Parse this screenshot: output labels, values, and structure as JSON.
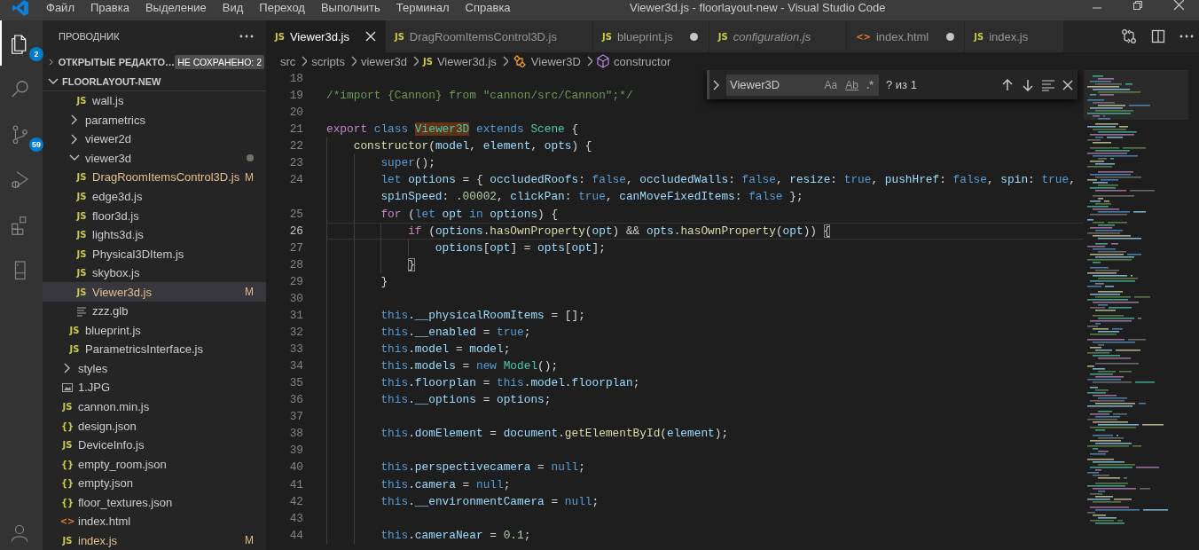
{
  "title_bar": {
    "menu": [
      "Файл",
      "Правка",
      "Выделение",
      "Вид",
      "Переход",
      "Выполнить",
      "Терминал",
      "Справка"
    ],
    "title": "Viewer3d.js - floorlayout-new - Visual Studio Code"
  },
  "activity_bar": {
    "items": [
      {
        "kind": "explorer",
        "selected": true,
        "badge": "2"
      },
      {
        "kind": "search",
        "selected": false
      },
      {
        "kind": "source-control",
        "selected": false,
        "badge": "59"
      },
      {
        "kind": "run-debug",
        "selected": false
      },
      {
        "kind": "extensions",
        "selected": false
      },
      {
        "kind": "device",
        "selected": false
      }
    ],
    "bottom": [
      {
        "kind": "account",
        "selected": false
      }
    ]
  },
  "sidebar": {
    "title": "ПРОВОДНИК",
    "sections": [
      {
        "label": "ОТКРЫТЫЕ РЕДАКТО…",
        "expanded": false,
        "badge": "НЕ СОХРАНЕНО: 2"
      },
      {
        "label": "FLOORLAYOUT-NEW",
        "expanded": true,
        "tree": [
          {
            "children": [
              {
                "children": [
                  {
                    "label": "wall.js",
                    "kind": "js",
                    "icon": "JS",
                    "selected": false
                  }
                ]
              },
              {
                "label": "parametrics",
                "kind": "folder",
                "expanded": false,
                "selected": false
              },
              {
                "label": "viewer2d",
                "kind": "folder",
                "expanded": false,
                "selected": false
              },
              {
                "label": "viewer3d",
                "kind": "folder",
                "expanded": true,
                "modified": true,
                "selected": false,
                "children": [
                  {
                    "label": "DragRoomItemsControl3D.js",
                    "kind": "js",
                    "icon": "JS",
                    "status": "M",
                    "selected": false
                  },
                  {
                    "label": "edge3d.js",
                    "kind": "js",
                    "icon": "JS",
                    "selected": false
                  },
                  {
                    "label": "floor3d.js",
                    "kind": "js",
                    "icon": "JS",
                    "selected": false
                  },
                  {
                    "label": "lights3d.js",
                    "kind": "js",
                    "icon": "JS",
                    "selected": false
                  },
                  {
                    "label": "Physical3DItem.js",
                    "kind": "js",
                    "icon": "JS",
                    "selected": false
                  },
                  {
                    "label": "skybox.js",
                    "kind": "js",
                    "icon": "JS",
                    "selected": false
                  },
                  {
                    "label": "Viewer3d.js",
                    "kind": "js",
                    "icon": "JS",
                    "status": "M",
                    "selected": true
                  },
                  {
                    "label": "zzz.glb",
                    "kind": "text",
                    "selected": false
                  }
                ]
              },
              {
                "label": "blueprint.js",
                "kind": "js",
                "icon": "JS",
                "selected": false
              },
              {
                "label": "ParametricsInterface.js",
                "kind": "js",
                "icon": "JS",
                "selected": false
              }
            ]
          },
          {
            "label": "styles",
            "kind": "folder",
            "expanded": false,
            "selected": false
          },
          {
            "label": "1.JPG",
            "kind": "image",
            "selected": false
          },
          {
            "label": "cannon.min.js",
            "kind": "js",
            "icon": "JS",
            "selected": false
          },
          {
            "label": "design.json",
            "kind": "json",
            "icon": "{}",
            "selected": false
          },
          {
            "label": "DeviceInfo.js",
            "kind": "js",
            "icon": "JS",
            "selected": false
          },
          {
            "label": "empty_room.json",
            "kind": "json",
            "icon": "{}",
            "selected": false
          },
          {
            "label": "empty.json",
            "kind": "json",
            "icon": "{}",
            "selected": false
          },
          {
            "label": "floor_textures.json",
            "kind": "json",
            "icon": "{}",
            "selected": false
          },
          {
            "label": "index.html",
            "kind": "html",
            "icon": "<>",
            "selected": false
          },
          {
            "label": "index.js",
            "kind": "js",
            "icon": "JS",
            "status": "M",
            "selected": false
          }
        ]
      }
    ]
  },
  "tabs": [
    {
      "label": "Viewer3d.js",
      "kind": "js",
      "icon": "JS",
      "selected": true,
      "dirty": false,
      "preview": false
    },
    {
      "label": "DragRoomItemsControl3D.js",
      "kind": "js",
      "icon": "JS",
      "selected": false,
      "dirty": false,
      "preview": false
    },
    {
      "label": "blueprint.js",
      "kind": "js",
      "icon": "JS",
      "selected": false,
      "dirty": true,
      "preview": false
    },
    {
      "label": "configuration.js",
      "kind": "js",
      "icon": "JS",
      "selected": false,
      "dirty": false,
      "preview": true
    },
    {
      "label": "index.html",
      "kind": "html",
      "icon": "<>",
      "selected": false,
      "dirty": true,
      "preview": false
    },
    {
      "label": "index.js",
      "kind": "js",
      "icon": "JS",
      "selected": false,
      "dirty": false,
      "preview": false
    }
  ],
  "breadcrumbs": [
    {
      "label": "src",
      "kind": "folder"
    },
    {
      "label": "scripts",
      "kind": "folder"
    },
    {
      "label": "viewer3d",
      "kind": "folder"
    },
    {
      "label": "Viewer3d.js",
      "kind": "js",
      "icon": "JS"
    },
    {
      "label": "Viewer3D",
      "kind": "class"
    },
    {
      "label": "constructor",
      "kind": "method"
    }
  ],
  "find_widget": {
    "expanded": false,
    "value": "Viewer3D",
    "options": [
      {
        "kind": "match-case",
        "label": "Aa",
        "on": false
      },
      {
        "kind": "whole-word",
        "label": "Ab",
        "on": false
      },
      {
        "kind": "regex",
        "label": ".*",
        "on": false
      }
    ],
    "result": "? из 1"
  },
  "editor": {
    "lines": [
      {
        "number": "18",
        "current": false
      },
      {
        "number": "19",
        "current": false,
        "tokens": [
          {
            "kind": "comment",
            "text": "/*import {Cannon} from \"cannon/src/Cannon\";*/"
          }
        ]
      },
      {
        "number": "20",
        "current": false
      },
      {
        "number": "21",
        "current": false,
        "tokens": [
          {
            "kind": "control",
            "text": "export "
          },
          {
            "kind": "keyword",
            "text": "class "
          },
          {
            "kind": "find-match",
            "text": "Viewer3D"
          },
          {
            "kind": "keyword",
            "text": " extends "
          },
          {
            "kind": "type",
            "text": "Scene"
          },
          {
            "kind": "plain",
            "text": " {"
          }
        ]
      },
      {
        "number": "22",
        "current": false,
        "tokens": [
          {
            "kind": "function",
            "text": "    constructor"
          },
          {
            "kind": "plain",
            "text": "("
          },
          {
            "kind": "variable",
            "text": "model"
          },
          {
            "kind": "plain",
            "text": ", "
          },
          {
            "kind": "variable",
            "text": "element"
          },
          {
            "kind": "plain",
            "text": ", "
          },
          {
            "kind": "variable",
            "text": "opts"
          },
          {
            "kind": "plain",
            "text": ") {"
          }
        ]
      },
      {
        "number": "23",
        "current": false,
        "tokens": [
          {
            "kind": "keyword",
            "text": "        super"
          },
          {
            "kind": "plain",
            "text": "();"
          }
        ]
      },
      {
        "number": "24",
        "current": false,
        "tokens": [
          {
            "kind": "keyword",
            "text": "        let "
          },
          {
            "kind": "variable",
            "text": "options"
          },
          {
            "kind": "plain",
            "text": " = { "
          },
          {
            "kind": "variable",
            "text": "occludedRoofs"
          },
          {
            "kind": "plain",
            "text": ": "
          },
          {
            "kind": "keyword",
            "text": "false"
          },
          {
            "kind": "plain",
            "text": ", "
          },
          {
            "kind": "variable",
            "text": "occludedWalls"
          },
          {
            "kind": "plain",
            "text": ": "
          },
          {
            "kind": "keyword",
            "text": "false"
          },
          {
            "kind": "plain",
            "text": ", "
          },
          {
            "kind": "variable",
            "text": "resize"
          },
          {
            "kind": "plain",
            "text": ": "
          },
          {
            "kind": "keyword",
            "text": "true"
          },
          {
            "kind": "plain",
            "text": ", "
          },
          {
            "kind": "variable",
            "text": "pushHref"
          },
          {
            "kind": "plain",
            "text": ": "
          },
          {
            "kind": "keyword",
            "text": "false"
          },
          {
            "kind": "plain",
            "text": ", "
          },
          {
            "kind": "variable",
            "text": "spin"
          },
          {
            "kind": "plain",
            "text": ": "
          },
          {
            "kind": "keyword",
            "text": "true"
          },
          {
            "kind": "plain",
            "text": ","
          }
        ]
      },
      {
        "current": false,
        "tokens": [
          {
            "kind": "variable",
            "text": "        spinSpeed"
          },
          {
            "kind": "plain",
            "text": ": "
          },
          {
            "kind": "number",
            "text": ".00002"
          },
          {
            "kind": "plain",
            "text": ", "
          },
          {
            "kind": "variable",
            "text": "clickPan"
          },
          {
            "kind": "plain",
            "text": ": "
          },
          {
            "kind": "keyword",
            "text": "true"
          },
          {
            "kind": "plain",
            "text": ", "
          },
          {
            "kind": "variable",
            "text": "canMoveFixedItems"
          },
          {
            "kind": "plain",
            "text": ": "
          },
          {
            "kind": "keyword",
            "text": "false"
          },
          {
            "kind": "plain",
            "text": " };"
          }
        ]
      },
      {
        "number": "25",
        "current": false,
        "tokens": [
          {
            "kind": "control",
            "text": "        for"
          },
          {
            "kind": "plain",
            "text": " ("
          },
          {
            "kind": "keyword",
            "text": "let "
          },
          {
            "kind": "variable",
            "text": "opt"
          },
          {
            "kind": "keyword",
            "text": " in "
          },
          {
            "kind": "variable",
            "text": "options"
          },
          {
            "kind": "plain",
            "text": ") {"
          }
        ]
      },
      {
        "number": "26",
        "current": true,
        "tokens": [
          {
            "kind": "control",
            "text": "            if"
          },
          {
            "kind": "plain",
            "text": " ("
          },
          {
            "kind": "variable",
            "text": "options"
          },
          {
            "kind": "plain",
            "text": "."
          },
          {
            "kind": "function",
            "text": "hasOwnProperty"
          },
          {
            "kind": "plain",
            "text": "("
          },
          {
            "kind": "variable",
            "text": "opt"
          },
          {
            "kind": "plain",
            "text": ") && "
          },
          {
            "kind": "variable",
            "text": "opts"
          },
          {
            "kind": "plain",
            "text": "."
          },
          {
            "kind": "function",
            "text": "hasOwnProperty"
          },
          {
            "kind": "plain",
            "text": "("
          },
          {
            "kind": "variable",
            "text": "opt"
          },
          {
            "kind": "plain",
            "text": ")) "
          },
          {
            "kind": "bracket-match",
            "text": "{"
          }
        ]
      },
      {
        "number": "27",
        "current": false,
        "tokens": [
          {
            "kind": "variable",
            "text": "                options"
          },
          {
            "kind": "plain",
            "text": "["
          },
          {
            "kind": "variable",
            "text": "opt"
          },
          {
            "kind": "plain",
            "text": "] = "
          },
          {
            "kind": "variable",
            "text": "opts"
          },
          {
            "kind": "plain",
            "text": "["
          },
          {
            "kind": "variable",
            "text": "opt"
          },
          {
            "kind": "plain",
            "text": "];"
          }
        ]
      },
      {
        "number": "28",
        "current": false,
        "tokens": [
          {
            "kind": "bracket-match",
            "text": "            }"
          }
        ]
      },
      {
        "number": "29",
        "current": false,
        "tokens": [
          {
            "kind": "plain",
            "text": "        }"
          }
        ]
      },
      {
        "number": "30",
        "current": false
      },
      {
        "number": "31",
        "current": false,
        "tokens": [
          {
            "kind": "keyword",
            "text": "        this"
          },
          {
            "kind": "plain",
            "text": "."
          },
          {
            "kind": "variable",
            "text": "__physicalRoomItems"
          },
          {
            "kind": "plain",
            "text": " = [];"
          }
        ]
      },
      {
        "number": "32",
        "current": false,
        "tokens": [
          {
            "kind": "keyword",
            "text": "        this"
          },
          {
            "kind": "plain",
            "text": "."
          },
          {
            "kind": "variable",
            "text": "__enabled"
          },
          {
            "kind": "plain",
            "text": " = "
          },
          {
            "kind": "keyword",
            "text": "true"
          },
          {
            "kind": "plain",
            "text": ";"
          }
        ]
      },
      {
        "number": "33",
        "current": false,
        "tokens": [
          {
            "kind": "keyword",
            "text": "        this"
          },
          {
            "kind": "plain",
            "text": "."
          },
          {
            "kind": "variable",
            "text": "model"
          },
          {
            "kind": "plain",
            "text": " = "
          },
          {
            "kind": "variable",
            "text": "model"
          },
          {
            "kind": "plain",
            "text": ";"
          }
        ]
      },
      {
        "number": "34",
        "current": false,
        "tokens": [
          {
            "kind": "keyword",
            "text": "        this"
          },
          {
            "kind": "plain",
            "text": "."
          },
          {
            "kind": "variable",
            "text": "models"
          },
          {
            "kind": "plain",
            "text": " = "
          },
          {
            "kind": "keyword",
            "text": "new "
          },
          {
            "kind": "type",
            "text": "Model"
          },
          {
            "kind": "plain",
            "text": "();"
          }
        ]
      },
      {
        "number": "35",
        "current": false,
        "tokens": [
          {
            "kind": "keyword",
            "text": "        this"
          },
          {
            "kind": "plain",
            "text": "."
          },
          {
            "kind": "variable",
            "text": "floorplan"
          },
          {
            "kind": "plain",
            "text": " = "
          },
          {
            "kind": "keyword",
            "text": "this"
          },
          {
            "kind": "plain",
            "text": "."
          },
          {
            "kind": "variable",
            "text": "model"
          },
          {
            "kind": "plain",
            "text": "."
          },
          {
            "kind": "variable",
            "text": "floorplan"
          },
          {
            "kind": "plain",
            "text": ";"
          }
        ]
      },
      {
        "number": "36",
        "current": false,
        "tokens": [
          {
            "kind": "keyword",
            "text": "        this"
          },
          {
            "kind": "plain",
            "text": "."
          },
          {
            "kind": "variable",
            "text": "__options"
          },
          {
            "kind": "plain",
            "text": " = "
          },
          {
            "kind": "variable",
            "text": "options"
          },
          {
            "kind": "plain",
            "text": ";"
          }
        ]
      },
      {
        "number": "37",
        "current": false
      },
      {
        "number": "38",
        "current": false,
        "tokens": [
          {
            "kind": "keyword",
            "text": "        this"
          },
          {
            "kind": "plain",
            "text": "."
          },
          {
            "kind": "variable",
            "text": "domElement"
          },
          {
            "kind": "plain",
            "text": " = "
          },
          {
            "kind": "variable",
            "text": "document"
          },
          {
            "kind": "plain",
            "text": "."
          },
          {
            "kind": "function",
            "text": "getElementById"
          },
          {
            "kind": "plain",
            "text": "("
          },
          {
            "kind": "variable",
            "text": "element"
          },
          {
            "kind": "plain",
            "text": ");"
          }
        ]
      },
      {
        "number": "39",
        "current": false
      },
      {
        "number": "40",
        "current": false,
        "tokens": [
          {
            "kind": "keyword",
            "text": "        this"
          },
          {
            "kind": "plain",
            "text": "."
          },
          {
            "kind": "variable",
            "text": "perspectivecamera"
          },
          {
            "kind": "plain",
            "text": " = "
          },
          {
            "kind": "keyword",
            "text": "null"
          },
          {
            "kind": "plain",
            "text": ";"
          }
        ]
      },
      {
        "number": "41",
        "current": false,
        "tokens": [
          {
            "kind": "keyword",
            "text": "        this"
          },
          {
            "kind": "plain",
            "text": "."
          },
          {
            "kind": "variable",
            "text": "camera"
          },
          {
            "kind": "plain",
            "text": " = "
          },
          {
            "kind": "keyword",
            "text": "null"
          },
          {
            "kind": "plain",
            "text": ";"
          }
        ]
      },
      {
        "number": "42",
        "current": false,
        "tokens": [
          {
            "kind": "keyword",
            "text": "        this"
          },
          {
            "kind": "plain",
            "text": "."
          },
          {
            "kind": "variable",
            "text": "__environmentCamera"
          },
          {
            "kind": "plain",
            "text": " = "
          },
          {
            "kind": "keyword",
            "text": "null"
          },
          {
            "kind": "plain",
            "text": ";"
          }
        ]
      },
      {
        "number": "43",
        "current": false
      },
      {
        "number": "44",
        "current": false,
        "tokens": [
          {
            "kind": "keyword",
            "text": "        this"
          },
          {
            "kind": "plain",
            "text": "."
          },
          {
            "kind": "variable",
            "text": "cameraNear"
          },
          {
            "kind": "plain",
            "text": " = "
          },
          {
            "kind": "number",
            "text": "0.1"
          },
          {
            "kind": "plain",
            "text": ";"
          }
        ]
      }
    ]
  }
}
